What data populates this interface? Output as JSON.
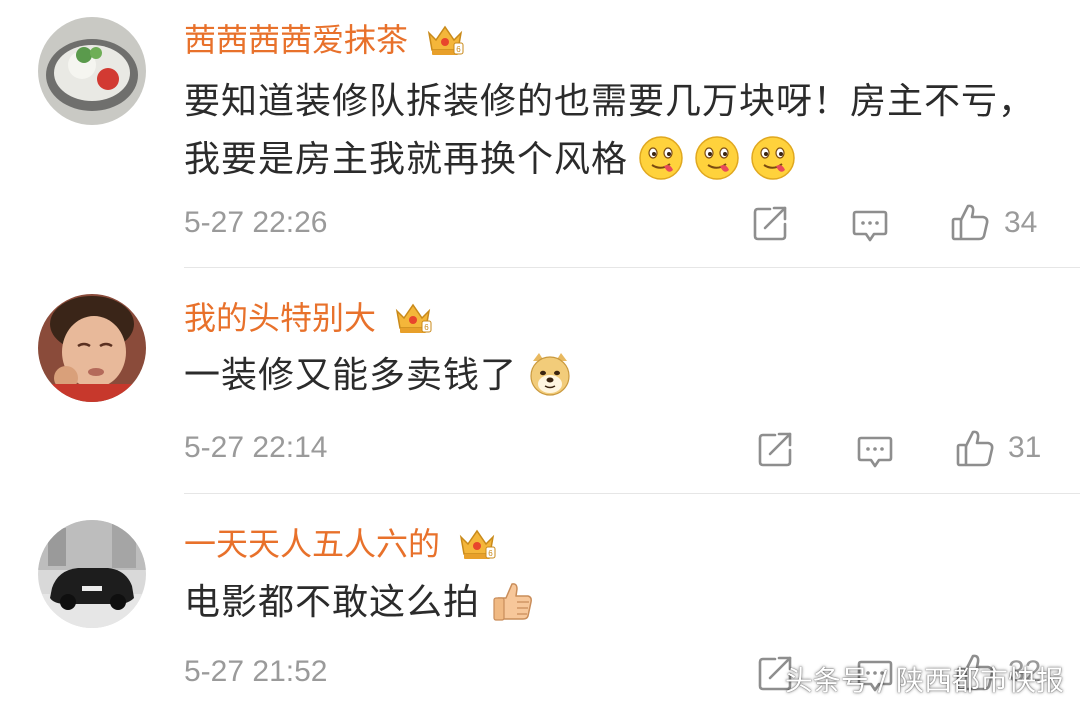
{
  "comments": [
    {
      "username": "茜茜茜茜爱抹茶",
      "text": "要知道装修队拆装修的也需要几万块呀！房主不亏，我要是房主我就再换个风格",
      "timestamp": "5-27 22:26",
      "likes": "34",
      "emojis": [
        "drool-emoji",
        "drool-emoji",
        "drool-emoji"
      ]
    },
    {
      "username": "我的头特别大",
      "text": "一装修又能多卖钱了",
      "timestamp": "5-27 22:14",
      "likes": "31",
      "emojis": [
        "doge-emoji"
      ]
    },
    {
      "username": "一天天人五人六的",
      "text": "电影都不敢这么拍",
      "timestamp": "5-27 21:52",
      "likes": "32",
      "emojis": [
        "thumbs-up-emoji"
      ]
    }
  ],
  "watermark": "头条号 / 陕西都市快报",
  "colors": {
    "username": "#e8712b",
    "text": "#2b2b2b",
    "meta": "#9a9a9a",
    "divider": "#e6e6e6"
  }
}
